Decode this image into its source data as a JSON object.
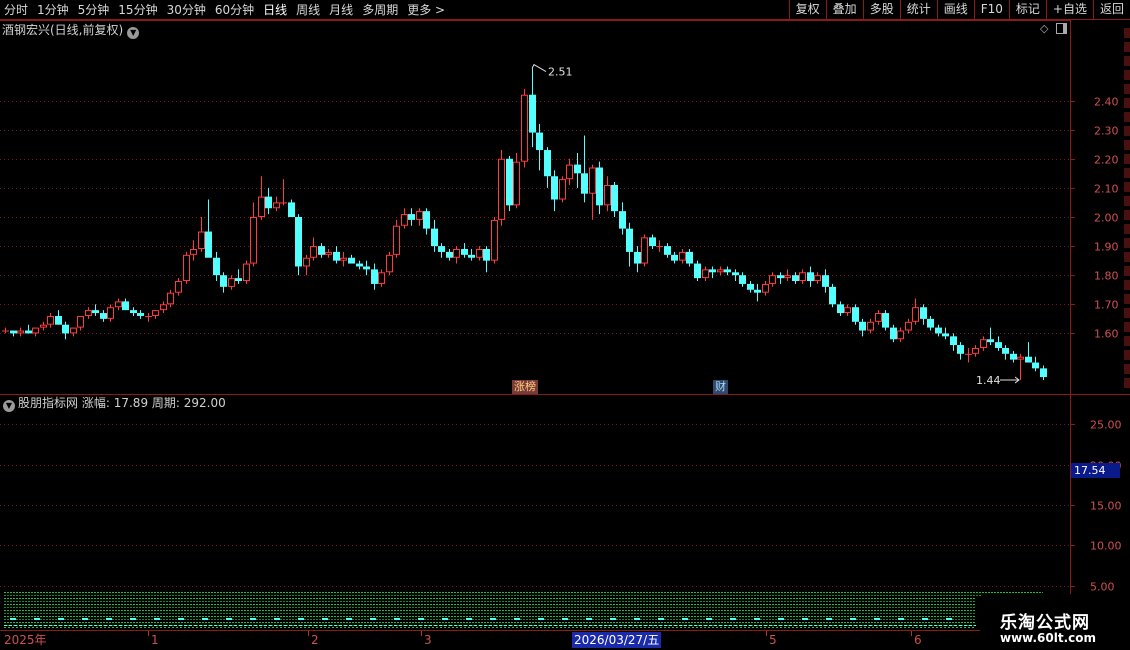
{
  "toolbar": {
    "periods": [
      "分时",
      "1分钟",
      "5分钟",
      "15分钟",
      "30分钟",
      "60分钟",
      "日线",
      "周线",
      "月线",
      "多周期",
      "更多 >"
    ],
    "active_period": "日线",
    "tools": [
      "复权",
      "叠加",
      "多股",
      "统计",
      "画线",
      "F10",
      "标记",
      "+自选",
      "返回"
    ]
  },
  "main_chart": {
    "title": "酒钢宏兴(日线,前复权)",
    "y_ticks": [
      "2.40",
      "2.30",
      "2.20",
      "2.10",
      "2.00",
      "1.90",
      "1.80",
      "1.70",
      "1.60"
    ],
    "high_label": "2.51",
    "low_label": "1.44",
    "event_tags": {
      "limit_list": "涨榜",
      "finance": "财"
    }
  },
  "indicator": {
    "name": "股朋指标网",
    "field1_label": "涨幅:",
    "field1_value": "17.89",
    "field2_label": "周期:",
    "field2_value": "292.00",
    "y_ticks": [
      "25.00",
      "20.00",
      "15.00",
      "10.00",
      "5.00"
    ],
    "current_value": "17.54"
  },
  "date_axis": {
    "labels": [
      "2025年",
      "1",
      "2",
      "3",
      "5",
      "6"
    ],
    "cursor": "2026/03/27/五"
  },
  "watermark": {
    "title": "乐淘公式网",
    "url": "www.60lt.com"
  },
  "colors": {
    "up": "#ff3c3c",
    "down": "#54ffff",
    "axis": "#8b1a1a",
    "label": "#d05050"
  },
  "chart_data": {
    "type": "candlestick",
    "ylim": [
      1.44,
      2.51
    ],
    "candles": [
      [
        1.61,
        1.62,
        1.6,
        1.61
      ],
      [
        1.61,
        1.61,
        1.59,
        1.6
      ],
      [
        1.6,
        1.62,
        1.59,
        1.61
      ],
      [
        1.61,
        1.63,
        1.6,
        1.6
      ],
      [
        1.6,
        1.62,
        1.59,
        1.62
      ],
      [
        1.62,
        1.64,
        1.61,
        1.63
      ],
      [
        1.63,
        1.67,
        1.62,
        1.66
      ],
      [
        1.66,
        1.68,
        1.63,
        1.63
      ],
      [
        1.63,
        1.64,
        1.58,
        1.6
      ],
      [
        1.6,
        1.62,
        1.59,
        1.62
      ],
      [
        1.62,
        1.66,
        1.61,
        1.66
      ],
      [
        1.66,
        1.69,
        1.65,
        1.68
      ],
      [
        1.68,
        1.7,
        1.66,
        1.67
      ],
      [
        1.67,
        1.68,
        1.64,
        1.65
      ],
      [
        1.65,
        1.7,
        1.64,
        1.69
      ],
      [
        1.69,
        1.72,
        1.68,
        1.71
      ],
      [
        1.71,
        1.72,
        1.68,
        1.68
      ],
      [
        1.68,
        1.69,
        1.66,
        1.67
      ],
      [
        1.67,
        1.68,
        1.65,
        1.66
      ],
      [
        1.66,
        1.67,
        1.64,
        1.66
      ],
      [
        1.66,
        1.68,
        1.65,
        1.68
      ],
      [
        1.68,
        1.71,
        1.67,
        1.7
      ],
      [
        1.7,
        1.75,
        1.69,
        1.74
      ],
      [
        1.74,
        1.79,
        1.73,
        1.78
      ],
      [
        1.78,
        1.88,
        1.77,
        1.87
      ],
      [
        1.87,
        1.92,
        1.85,
        1.89
      ],
      [
        1.89,
        2.0,
        1.88,
        1.95
      ],
      [
        1.95,
        2.06,
        1.91,
        1.86
      ],
      [
        1.86,
        1.88,
        1.78,
        1.8
      ],
      [
        1.8,
        1.81,
        1.74,
        1.76
      ],
      [
        1.76,
        1.8,
        1.75,
        1.79
      ],
      [
        1.79,
        1.82,
        1.77,
        1.78
      ],
      [
        1.78,
        1.85,
        1.77,
        1.84
      ],
      [
        1.84,
        2.05,
        1.83,
        2.0
      ],
      [
        2.0,
        2.14,
        1.99,
        2.07
      ],
      [
        2.07,
        2.1,
        2.01,
        2.03
      ],
      [
        2.03,
        2.07,
        2.02,
        2.05
      ],
      [
        2.05,
        2.13,
        2.04,
        2.05
      ],
      [
        2.05,
        2.06,
        2.0,
        2.0
      ],
      [
        2.0,
        2.01,
        1.8,
        1.83
      ],
      [
        1.83,
        1.87,
        1.8,
        1.86
      ],
      [
        1.86,
        1.93,
        1.85,
        1.9
      ],
      [
        1.9,
        1.91,
        1.86,
        1.87
      ],
      [
        1.87,
        1.89,
        1.86,
        1.88
      ],
      [
        1.88,
        1.9,
        1.84,
        1.85
      ],
      [
        1.85,
        1.88,
        1.83,
        1.86
      ],
      [
        1.86,
        1.87,
        1.84,
        1.84
      ],
      [
        1.84,
        1.85,
        1.82,
        1.83
      ],
      [
        1.83,
        1.85,
        1.8,
        1.82
      ],
      [
        1.82,
        1.84,
        1.75,
        1.77
      ],
      [
        1.77,
        1.82,
        1.76,
        1.81
      ],
      [
        1.81,
        1.88,
        1.8,
        1.87
      ],
      [
        1.87,
        1.99,
        1.86,
        1.97
      ],
      [
        1.97,
        2.03,
        1.96,
        2.01
      ],
      [
        2.01,
        2.03,
        1.97,
        1.99
      ],
      [
        1.99,
        2.03,
        1.97,
        2.02
      ],
      [
        2.02,
        2.03,
        1.94,
        1.96
      ],
      [
        1.96,
        1.99,
        1.88,
        1.9
      ],
      [
        1.9,
        1.91,
        1.86,
        1.88
      ],
      [
        1.88,
        1.89,
        1.85,
        1.86
      ],
      [
        1.86,
        1.9,
        1.84,
        1.89
      ],
      [
        1.89,
        1.91,
        1.86,
        1.87
      ],
      [
        1.87,
        1.89,
        1.85,
        1.86
      ],
      [
        1.86,
        1.9,
        1.85,
        1.89
      ],
      [
        1.89,
        1.9,
        1.81,
        1.85
      ],
      [
        1.85,
        2.0,
        1.84,
        1.99
      ],
      [
        1.99,
        2.23,
        1.97,
        2.2
      ],
      [
        2.2,
        2.21,
        2.02,
        2.04
      ],
      [
        2.04,
        2.22,
        2.03,
        2.19
      ],
      [
        2.19,
        2.44,
        2.17,
        2.42
      ],
      [
        2.42,
        2.51,
        2.24,
        2.29
      ],
      [
        2.29,
        2.32,
        2.16,
        2.23
      ],
      [
        2.23,
        2.24,
        2.1,
        2.14
      ],
      [
        2.14,
        2.16,
        2.02,
        2.06
      ],
      [
        2.06,
        2.14,
        2.05,
        2.13
      ],
      [
        2.13,
        2.2,
        2.11,
        2.18
      ],
      [
        2.18,
        2.22,
        2.1,
        2.15
      ],
      [
        2.15,
        2.28,
        2.05,
        2.08
      ],
      [
        2.08,
        2.18,
        1.99,
        2.17
      ],
      [
        2.17,
        2.19,
        2.01,
        2.04
      ],
      [
        2.04,
        2.14,
        2.02,
        2.11
      ],
      [
        2.11,
        2.12,
        2.0,
        2.02
      ],
      [
        2.02,
        2.05,
        1.94,
        1.96
      ],
      [
        1.96,
        1.98,
        1.83,
        1.88
      ],
      [
        1.88,
        1.9,
        1.81,
        1.84
      ],
      [
        1.84,
        1.94,
        1.83,
        1.93
      ],
      [
        1.93,
        1.94,
        1.89,
        1.9
      ],
      [
        1.9,
        1.92,
        1.88,
        1.9
      ],
      [
        1.9,
        1.91,
        1.86,
        1.87
      ],
      [
        1.87,
        1.88,
        1.84,
        1.85
      ],
      [
        1.85,
        1.89,
        1.84,
        1.88
      ],
      [
        1.88,
        1.89,
        1.83,
        1.84
      ],
      [
        1.84,
        1.85,
        1.78,
        1.79
      ],
      [
        1.79,
        1.83,
        1.78,
        1.82
      ],
      [
        1.82,
        1.83,
        1.79,
        1.81
      ],
      [
        1.81,
        1.83,
        1.8,
        1.82
      ],
      [
        1.82,
        1.83,
        1.8,
        1.81
      ],
      [
        1.81,
        1.82,
        1.78,
        1.8
      ],
      [
        1.8,
        1.81,
        1.76,
        1.77
      ],
      [
        1.77,
        1.78,
        1.74,
        1.75
      ],
      [
        1.75,
        1.77,
        1.71,
        1.74
      ],
      [
        1.74,
        1.78,
        1.73,
        1.77
      ],
      [
        1.77,
        1.81,
        1.76,
        1.8
      ],
      [
        1.8,
        1.81,
        1.77,
        1.79
      ],
      [
        1.79,
        1.82,
        1.78,
        1.8
      ],
      [
        1.8,
        1.81,
        1.77,
        1.78
      ],
      [
        1.78,
        1.82,
        1.77,
        1.81
      ],
      [
        1.81,
        1.83,
        1.76,
        1.78
      ],
      [
        1.78,
        1.81,
        1.77,
        1.8
      ],
      [
        1.8,
        1.82,
        1.74,
        1.76
      ],
      [
        1.76,
        1.77,
        1.69,
        1.7
      ],
      [
        1.7,
        1.71,
        1.66,
        1.67
      ],
      [
        1.67,
        1.7,
        1.66,
        1.69
      ],
      [
        1.69,
        1.7,
        1.63,
        1.64
      ],
      [
        1.64,
        1.65,
        1.59,
        1.61
      ],
      [
        1.61,
        1.65,
        1.6,
        1.64
      ],
      [
        1.64,
        1.68,
        1.63,
        1.67
      ],
      [
        1.67,
        1.68,
        1.61,
        1.62
      ],
      [
        1.62,
        1.63,
        1.57,
        1.58
      ],
      [
        1.58,
        1.62,
        1.57,
        1.61
      ],
      [
        1.61,
        1.65,
        1.6,
        1.64
      ],
      [
        1.64,
        1.72,
        1.63,
        1.69
      ],
      [
        1.69,
        1.7,
        1.63,
        1.65
      ],
      [
        1.65,
        1.66,
        1.61,
        1.62
      ],
      [
        1.62,
        1.63,
        1.59,
        1.6
      ],
      [
        1.6,
        1.62,
        1.58,
        1.59
      ],
      [
        1.59,
        1.6,
        1.54,
        1.56
      ],
      [
        1.56,
        1.57,
        1.51,
        1.53
      ],
      [
        1.53,
        1.55,
        1.5,
        1.53
      ],
      [
        1.53,
        1.56,
        1.52,
        1.55
      ],
      [
        1.55,
        1.59,
        1.54,
        1.58
      ],
      [
        1.58,
        1.62,
        1.56,
        1.57
      ],
      [
        1.57,
        1.59,
        1.54,
        1.55
      ],
      [
        1.55,
        1.56,
        1.51,
        1.53
      ],
      [
        1.53,
        1.54,
        1.5,
        1.51
      ],
      [
        1.51,
        1.53,
        1.44,
        1.52
      ],
      [
        1.52,
        1.57,
        1.51,
        1.5
      ],
      [
        1.5,
        1.52,
        1.47,
        1.48
      ],
      [
        1.48,
        1.49,
        1.44,
        1.45
      ]
    ],
    "indicator_ylim": [
      0,
      27
    ],
    "indicator_value": 17.54
  }
}
